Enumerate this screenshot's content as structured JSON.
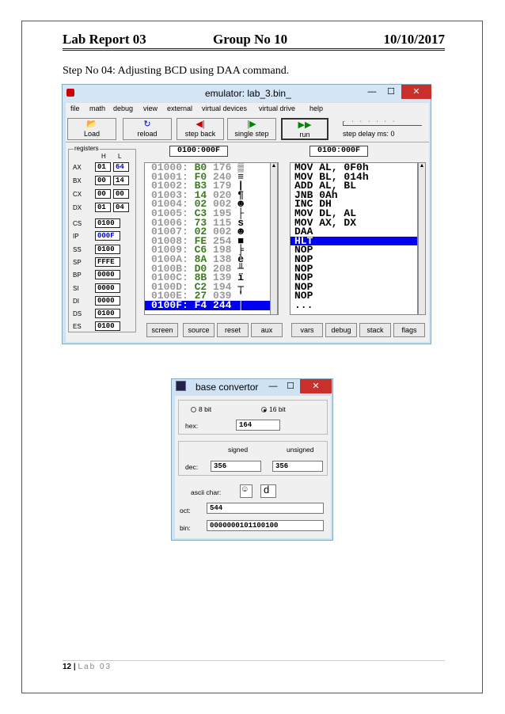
{
  "header": {
    "left": "Lab Report 03",
    "center": "Group No 10",
    "right": "10/10/2017"
  },
  "step_text": "Step No 04: Adjusting BCD using DAA command.",
  "emulator": {
    "title": "emulator: lab_3.bin_",
    "menu": [
      "file",
      "math",
      "debug",
      "view",
      "external",
      "virtual devices",
      "virtual drive",
      "help"
    ],
    "toolbar": {
      "load": "Load",
      "reload": "reload",
      "step_back": "step back",
      "single_step": "single step",
      "run": "run",
      "step_delay": "step delay ms: 0"
    },
    "mem_address": "0100:000F",
    "dis_address": "0100:000F",
    "registers_label": "registers",
    "h_label": "H",
    "l_label": "L",
    "regs8": [
      {
        "name": "AX",
        "h": "01",
        "l": "64"
      },
      {
        "name": "BX",
        "h": "00",
        "l": "14"
      },
      {
        "name": "CX",
        "h": "00",
        "l": "00"
      },
      {
        "name": "DX",
        "h": "01",
        "l": "04"
      }
    ],
    "regs16": [
      {
        "name": "CS",
        "val": "0100"
      },
      {
        "name": "IP",
        "val": "000F"
      },
      {
        "name": "SS",
        "val": "0100"
      },
      {
        "name": "SP",
        "val": "FFFE"
      },
      {
        "name": "BP",
        "val": "0000"
      },
      {
        "name": "SI",
        "val": "0000"
      },
      {
        "name": "DI",
        "val": "0000"
      },
      {
        "name": "DS",
        "val": "0100"
      },
      {
        "name": "ES",
        "val": "0100"
      }
    ],
    "memory": [
      {
        "addr": "01000:",
        "hex": "B0",
        "dec": "176",
        "ch": "▒"
      },
      {
        "addr": "01001:",
        "hex": "F0",
        "dec": "240",
        "ch": "≡"
      },
      {
        "addr": "01002:",
        "hex": "B3",
        "dec": "179",
        "ch": "|"
      },
      {
        "addr": "01003:",
        "hex": "14",
        "dec": "020",
        "ch": "¶"
      },
      {
        "addr": "01004:",
        "hex": "02",
        "dec": "002",
        "ch": "☻"
      },
      {
        "addr": "01005:",
        "hex": "C3",
        "dec": "195",
        "ch": "├"
      },
      {
        "addr": "01006:",
        "hex": "73",
        "dec": "115",
        "ch": "s"
      },
      {
        "addr": "01007:",
        "hex": "02",
        "dec": "002",
        "ch": "☻"
      },
      {
        "addr": "01008:",
        "hex": "FE",
        "dec": "254",
        "ch": "■"
      },
      {
        "addr": "01009:",
        "hex": "C6",
        "dec": "198",
        "ch": "╞"
      },
      {
        "addr": "0100A:",
        "hex": "8A",
        "dec": "138",
        "ch": "è"
      },
      {
        "addr": "0100B:",
        "hex": "D0",
        "dec": "208",
        "ch": "╨"
      },
      {
        "addr": "0100C:",
        "hex": "8B",
        "dec": "139",
        "ch": "ï"
      },
      {
        "addr": "0100D:",
        "hex": "C2",
        "dec": "194",
        "ch": "┬"
      },
      {
        "addr": "0100E:",
        "hex": "27",
        "dec": "039",
        "ch": "'"
      },
      {
        "addr": "0100F:",
        "hex": "F4",
        "dec": "244",
        "ch": "⌠"
      }
    ],
    "disasm": [
      "MOV AL, 0F0h",
      "MOV BL, 014h",
      "ADD AL, BL",
      "JNB 0Ah",
      "INC DH",
      "MOV DL, AL",
      "MOV AX, DX",
      "DAA",
      "HLT",
      "NOP",
      "NOP",
      "NOP",
      "NOP",
      "NOP",
      "NOP",
      "..."
    ],
    "bottom_buttons": [
      "screen",
      "source",
      "reset",
      "aux",
      "vars",
      "debug",
      "stack",
      "flags"
    ]
  },
  "convertor": {
    "title": "base convertor",
    "radio_8bit": "8 bit",
    "radio_16bit": "16 bit",
    "hex_label": "hex:",
    "hex_value": "164",
    "signed_label": "signed",
    "unsigned_label": "unsigned",
    "dec_label": "dec:",
    "signed_value": "356",
    "unsigned_value": "356",
    "ascii_label": "ascii char:",
    "ascii_symbol": "☺",
    "ascii_char": "d",
    "oct_label": "oct:",
    "oct_value": "544",
    "bin_label": "bin:",
    "bin_value": "0000000101100100"
  },
  "footer": {
    "page": "12",
    "sep": "|",
    "label": "Lab 03"
  },
  "colors": {
    "window_bg": "#cfe2f3",
    "selection": "#0000ee",
    "hex_green": "#3a7d1e",
    "close": "#c9302c"
  }
}
